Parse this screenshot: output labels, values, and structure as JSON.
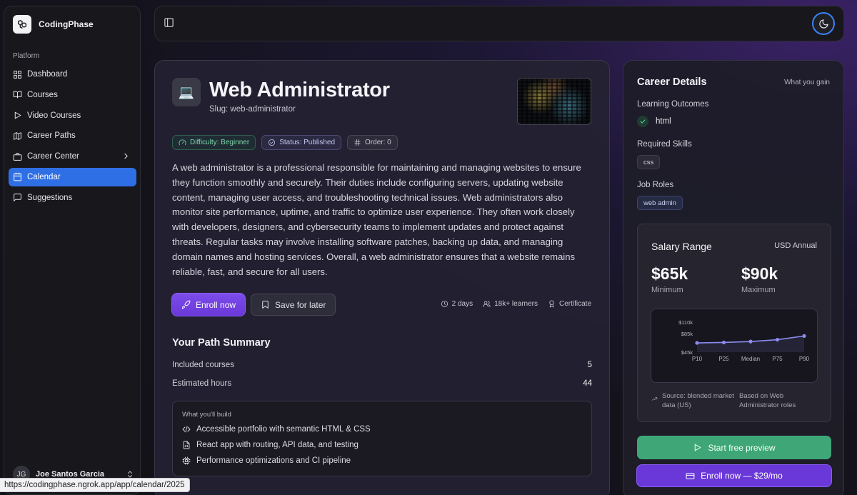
{
  "brand": {
    "name": "CodingPhase"
  },
  "sidebar": {
    "section": "Platform",
    "items": [
      {
        "label": "Dashboard",
        "icon": "grid-icon"
      },
      {
        "label": "Courses",
        "icon": "book-open-icon"
      },
      {
        "label": "Video Courses",
        "icon": "play-icon"
      },
      {
        "label": "Career Paths",
        "icon": "map-icon"
      },
      {
        "label": "Career Center",
        "icon": "briefcase-icon"
      },
      {
        "label": "Calendar",
        "icon": "calendar-icon",
        "active": true
      },
      {
        "label": "Suggestions",
        "icon": "message-square-icon"
      }
    ],
    "user": {
      "initials": "JG",
      "name": "Joe Santos Garcia"
    }
  },
  "course": {
    "icon": "💻",
    "title": "Web Administrator",
    "slug": "Slug: web-administrator",
    "badges": {
      "difficulty": "Difficulty: Beginner",
      "status": "Status: Published",
      "order": "Order: 0"
    },
    "description": "A web administrator is a professional responsible for maintaining and managing websites to ensure they function smoothly and securely. Their duties include configuring servers, updating website content, managing user access, and troubleshooting technical issues. Web administrators also monitor site performance, uptime, and traffic to optimize user experience. They often work closely with developers, designers, and cybersecurity teams to implement updates and protect against threats. Regular tasks may involve installing software patches, backing up data, and managing domain names and hosting services. Overall, a web administrator ensures that a website remains reliable, fast, and secure for all users.",
    "enroll_label": "Enroll now",
    "save_label": "Save for later",
    "meta": {
      "duration": "2 days",
      "learners": "18k+ learners",
      "certificate": "Certificate"
    }
  },
  "summary": {
    "title": "Your Path Summary",
    "rows": [
      {
        "label": "Included courses",
        "value": "5"
      },
      {
        "label": "Estimated hours",
        "value": "44"
      }
    ],
    "build_title": "What you'll build",
    "build_items": [
      "Accessible portfolio with semantic HTML & CSS",
      "React app with routing, API data, and testing",
      "Performance optimizations and CI pipeline"
    ]
  },
  "career": {
    "title": "Career Details",
    "hint": "What you gain",
    "outcomes_label": "Learning Outcomes",
    "outcome": "html",
    "skills_label": "Required Skills",
    "skill": "css",
    "roles_label": "Job Roles",
    "role": "web admin"
  },
  "salary": {
    "title": "Salary Range",
    "currency": "USD Annual",
    "min_value": "$65k",
    "min_label": "Minimum",
    "max_value": "$90k",
    "max_label": "Maximum",
    "source": "Source: blended market data (US)",
    "based_on": "Based on Web Administrator roles"
  },
  "chart_data": {
    "type": "line",
    "categories": [
      "P10",
      "P25",
      "Median",
      "P75",
      "P90"
    ],
    "values": [
      65,
      66,
      68,
      72,
      80
    ],
    "yticks": [
      "$110k",
      "$85k",
      "$45k"
    ],
    "ylim": [
      45,
      110
    ],
    "line_color": "#8b8cf0"
  },
  "cta": {
    "preview": "Start free preview",
    "enroll": "Enroll now — $29/mo"
  },
  "statusbar": {
    "url": "https://codingphase.ngrok.app/app/calendar/2025"
  },
  "colors": {
    "accent": "#6a38d8",
    "active_nav": "#2f6fe6",
    "success": "#3fa777"
  }
}
